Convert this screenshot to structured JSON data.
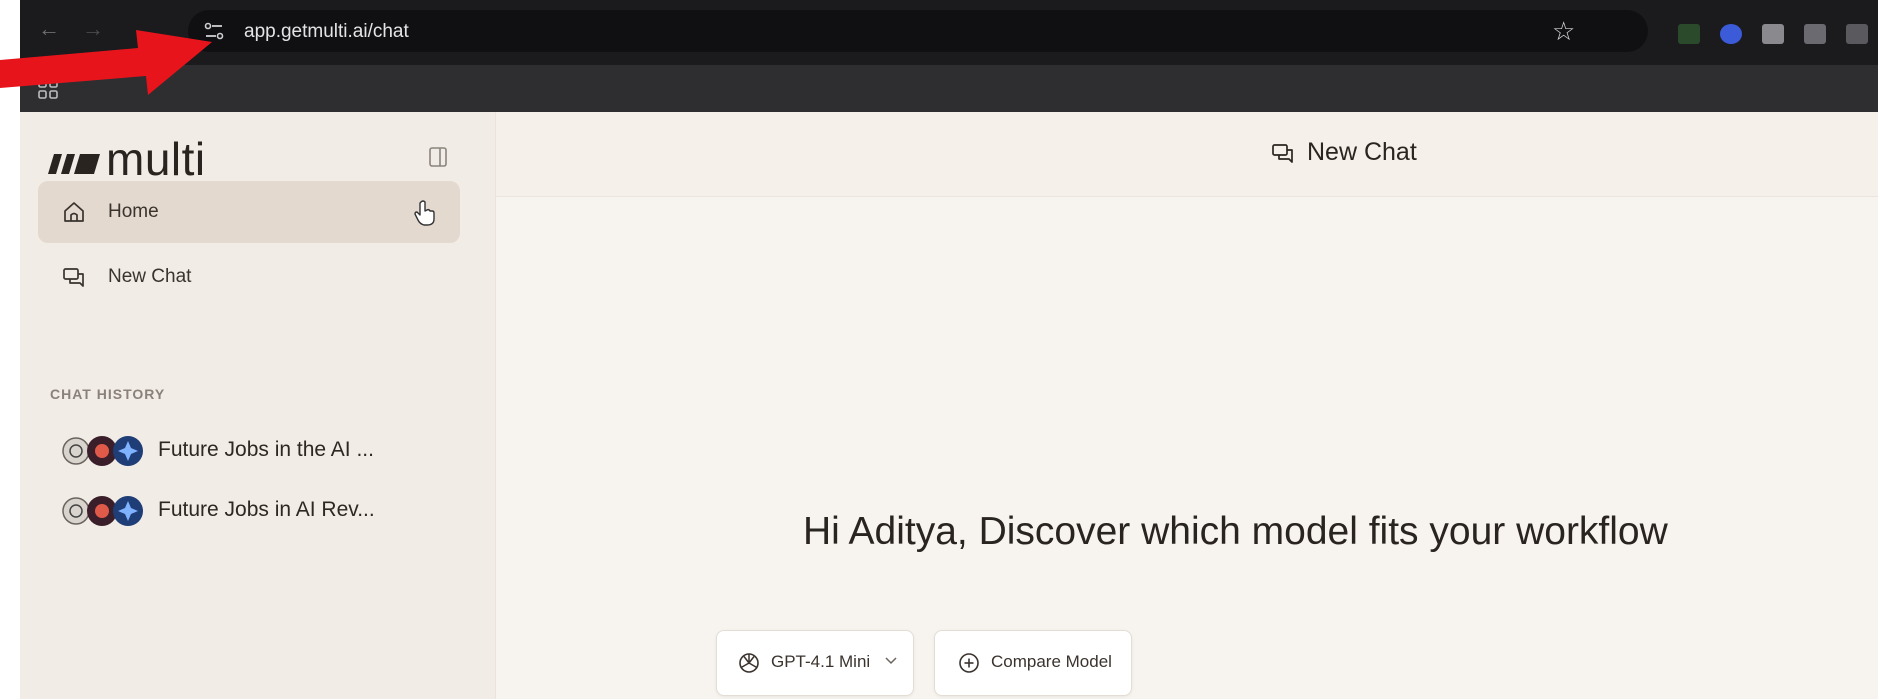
{
  "browser": {
    "url": "app.getmulti.ai/chat",
    "back_glyph": "←",
    "forward_glyph": "→",
    "bookmark_star": "☆"
  },
  "sidebar": {
    "logo_text": "multi",
    "nav": [
      {
        "label": "Home",
        "icon": "home-icon",
        "active": true
      },
      {
        "label": "New Chat",
        "icon": "chat-icon",
        "active": false
      }
    ],
    "history_heading": "CHAT HISTORY",
    "history": [
      {
        "title": "Future Jobs in the AI ..."
      },
      {
        "title": "Future Jobs in AI Rev..."
      }
    ]
  },
  "main": {
    "header_title": "New Chat",
    "greeting": "Hi Aditya, Discover which model fits your workflow",
    "model_select": {
      "value": "GPT-4.1 Mini"
    },
    "compare_button": "Compare Model"
  },
  "colors": {
    "annotation_arrow": "#e8141b",
    "sidebar_bg": "#f1ece6",
    "active_nav_bg": "#e3d9cf",
    "main_bg": "#f7f3ee"
  }
}
